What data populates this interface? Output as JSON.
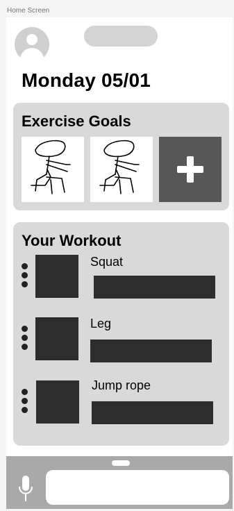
{
  "frame": {
    "label": "Home Screen"
  },
  "header": {
    "avatar_icon": "user-avatar-icon",
    "title": "Monday 05/01"
  },
  "exercise_goals": {
    "title": "Exercise Goals",
    "goals": [
      {
        "icon": "stick-figure-squat-sketch"
      },
      {
        "icon": "stick-figure-squat-sketch"
      }
    ],
    "add_icon": "plus-icon",
    "colors": {
      "card": "#d9d9d9",
      "add_tile": "#575757"
    }
  },
  "workout": {
    "title": "Your Workout",
    "items": [
      {
        "label": "Squat",
        "drag_icon": "drag-handle-icon"
      },
      {
        "label": "Leg",
        "drag_icon": "drag-handle-icon"
      },
      {
        "label": "Jump rope",
        "drag_icon": "drag-handle-icon"
      }
    ]
  },
  "bottom_bar": {
    "mic_icon": "microphone-icon",
    "input_value": "",
    "input_placeholder": ""
  }
}
